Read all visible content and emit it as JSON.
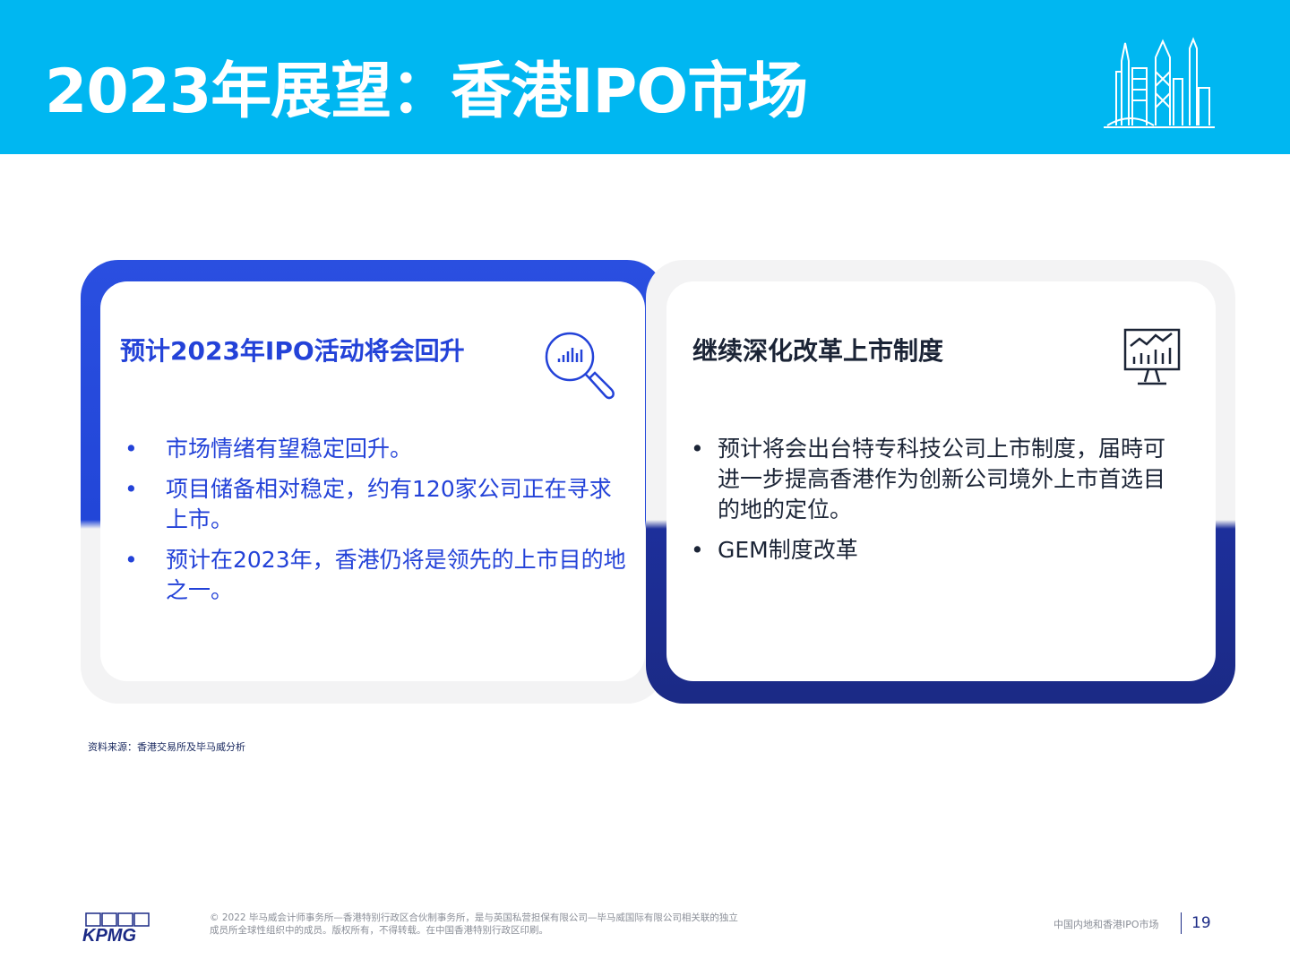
{
  "header": {
    "title": "2023年展望：香港IPO市场",
    "background_color": "#00b7f1",
    "skyline_icon": "hong-kong-skyline-icon"
  },
  "cards": [
    {
      "title": "预计2023年IPO活动将会回升",
      "icon": "magnifier-chart-icon",
      "accent_color": "#2342d8",
      "bullets": [
        "市场情绪有望稳定回升。",
        "项目储备相对稳定，约有120家公司正在寻求上市。",
        "预计在2023年，香港仍将是领先的上市目的地之一。"
      ]
    },
    {
      "title": "继续深化改革上市制度",
      "icon": "monitor-chart-icon",
      "accent_color": "#1b2a85",
      "bullets": [
        "预计将会出台特专科技公司上市制度，届時可进一步提高香港作为创新公司境外上市首选目的地的定位。",
        "GEM制度改革"
      ]
    }
  ],
  "bullet_symbol": "•",
  "source": "资料来源：香港交易所及毕马威分析",
  "footer": {
    "logo_text": "KPMG",
    "copyright": "© 2022 毕马威会计师事务所—香港特别行政区合伙制事务所，是与英国私营担保有限公司—毕马威国际有限公司相关联的独立成员所全球性组织中的成员。版权所有，不得转载。在中国香港特别行政区印刷。",
    "report_name": "中国内地和香港IPO市场",
    "page_number": "19"
  }
}
